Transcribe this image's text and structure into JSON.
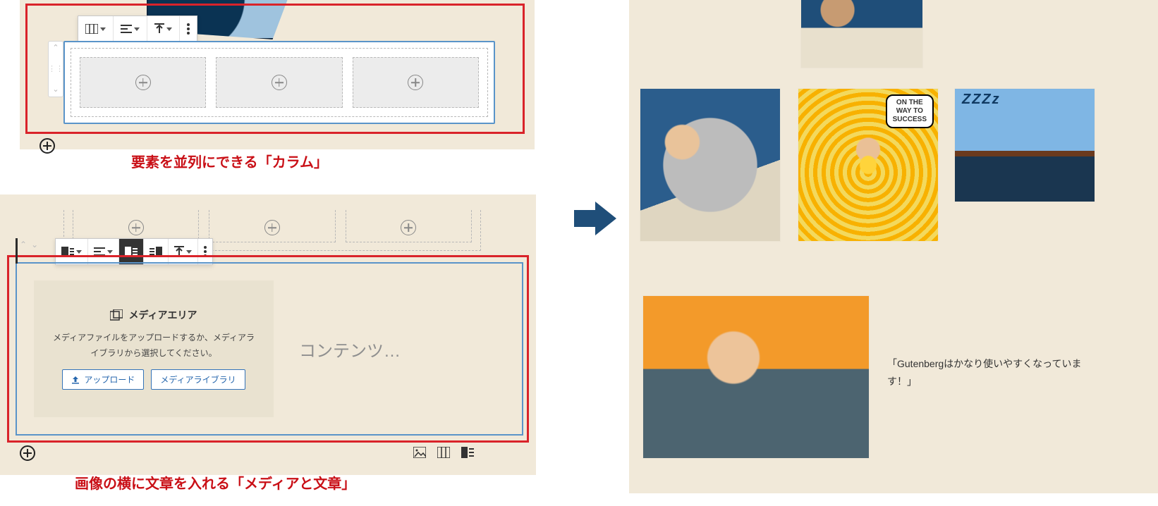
{
  "top": {
    "caption": "要素を並列にできる「カラム」"
  },
  "bottom": {
    "caption": "画像の横に文章を入れる「メディアと文章」",
    "media_area_title": "メディアエリア",
    "media_area_desc_line1": "メディアファイルをアップロードするか、メディアラ",
    "media_area_desc_line2": "イブラリから選択してください。",
    "upload_btn": "アップロード",
    "library_btn": "メディアライブラリ",
    "content_placeholder": "コンテンツ…"
  },
  "preview": {
    "bubble_line1": "ON THE",
    "bubble_line2": "WAY TO",
    "bubble_line3": "SUCCESS",
    "sleep_text": "ZZZz",
    "media_text": "「Gutenbergはかなり使いやすくなっています！」"
  }
}
